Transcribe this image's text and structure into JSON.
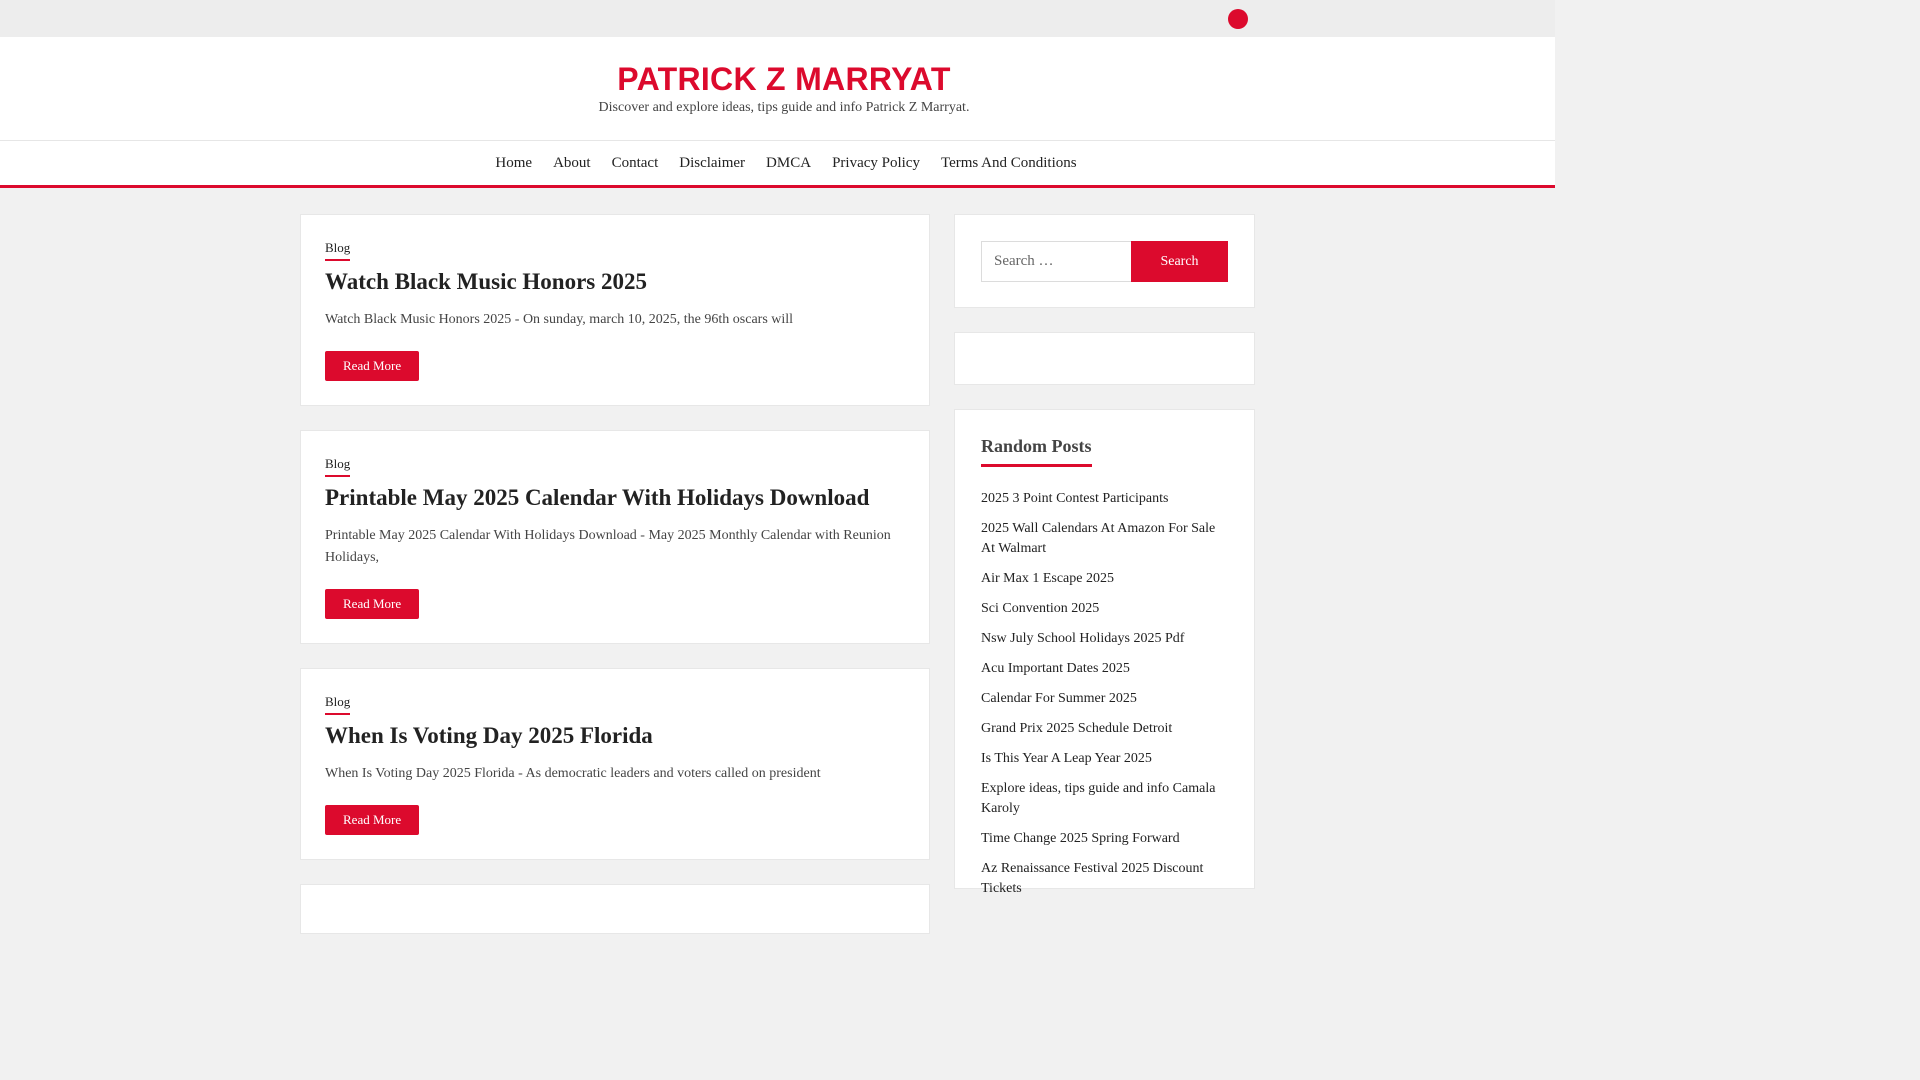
{
  "site": {
    "title": "PATRICK Z MARRYAT",
    "description": "Discover and explore ideas, tips guide and info Patrick Z Marryat."
  },
  "nav": {
    "items": [
      "Home",
      "About",
      "Contact",
      "Disclaimer",
      "DMCA",
      "Privacy Policy",
      "Terms And Conditions"
    ]
  },
  "posts": [
    {
      "category": "Blog",
      "title": "Watch Black Music Honors 2025",
      "excerpt": "Watch Black Music Honors 2025 - On sunday, march 10, 2025, the 96th oscars will",
      "read_more": "Read More"
    },
    {
      "category": "Blog",
      "title": "Printable May 2025 Calendar With Holidays Download",
      "excerpt": "Printable May 2025 Calendar With Holidays Download - May 2025 Monthly Calendar with Reunion Holidays,",
      "read_more": "Read More"
    },
    {
      "category": "Blog",
      "title": "When Is Voting Day 2025 Florida",
      "excerpt": "When Is Voting Day 2025 Florida - As democratic leaders and voters called on president",
      "read_more": "Read More"
    }
  ],
  "search": {
    "placeholder": "Search …",
    "button": "Search"
  },
  "random_posts": {
    "title": "Random Posts",
    "items": [
      "2025 3 Point Contest Participants",
      "2025 Wall Calendars At Amazon For Sale At Walmart",
      "Air Max 1 Escape 2025",
      "Sci Convention 2025",
      "Nsw July School Holidays 2025 Pdf",
      "Acu Important Dates 2025",
      "Calendar For Summer 2025",
      "Grand Prix 2025 Schedule Detroit",
      "Is This Year A Leap Year 2025",
      "Explore ideas, tips guide and info Camala Karoly",
      "Time Change 2025 Spring Forward",
      "Az Renaissance Festival 2025 Discount Tickets"
    ]
  },
  "colors": {
    "accent": "#dc0a2d",
    "background": "#f1f1f1",
    "card": "#ffffff"
  },
  "icons": {
    "top_search": "search-icon"
  }
}
